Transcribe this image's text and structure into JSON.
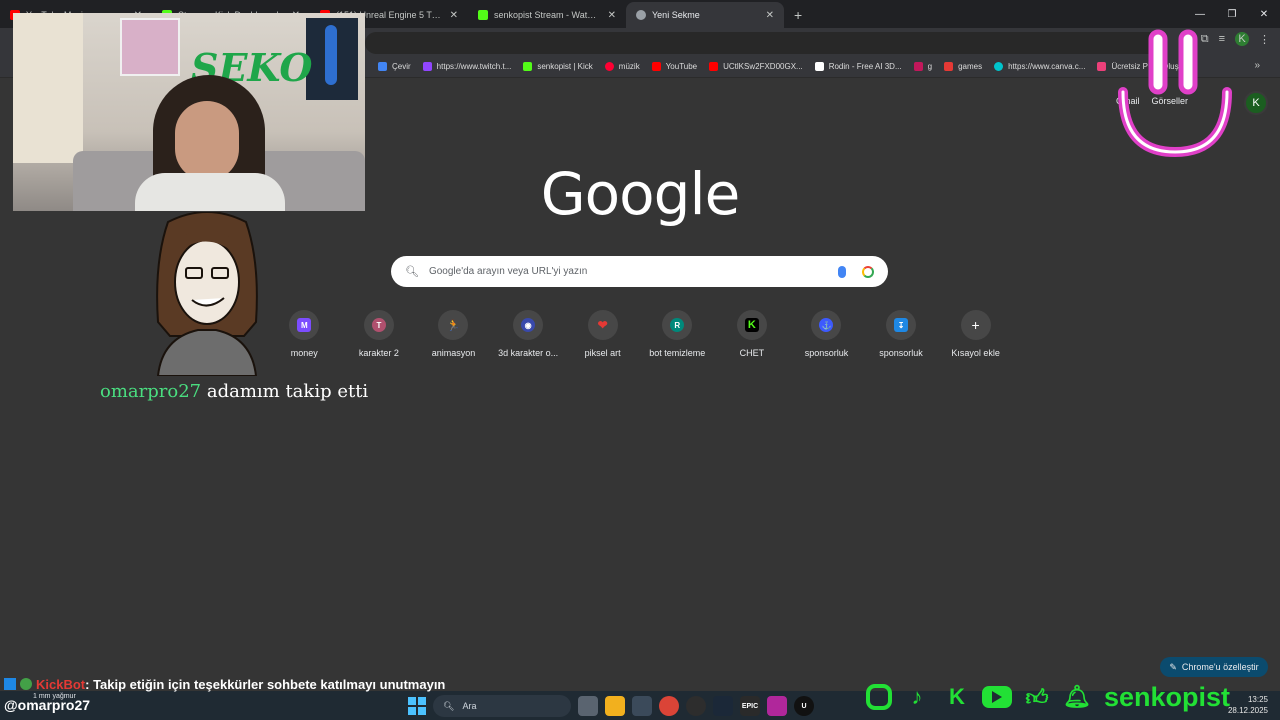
{
  "browser": {
    "tabs": [
      {
        "label": "YouTube Music",
        "favicon_color": "#ff0000",
        "active": false
      },
      {
        "label": "Stream - Kick Dashboard",
        "favicon_color": "#53fc18",
        "active": false
      },
      {
        "label": "(151) Unreal Engine 5 Tutorial",
        "favicon_color": "#ff0000",
        "active": false
      },
      {
        "label": "senkopist Stream - Watch Live on Kick",
        "favicon_color": "#53fc18",
        "active": false
      },
      {
        "label": "Yeni Sekme",
        "favicon_color": "#9aa0a6",
        "active": true
      }
    ],
    "new_tab_icon": "plus-icon",
    "bookmarks": [
      {
        "label": "Çevir",
        "color": "#4285f4"
      },
      {
        "label": "https://www.twitch.t...",
        "color": "#9146ff"
      },
      {
        "label": "senkopist | Kick",
        "color": "#53fc18"
      },
      {
        "label": "müzik",
        "color": "#ff0033"
      },
      {
        "label": "YouTube",
        "color": "#ff0000"
      },
      {
        "label": "UCtlKSw2FXD00GX...",
        "color": "#ff0000"
      },
      {
        "label": "Rodin - Free AI 3D...",
        "color": "#ffffff"
      },
      {
        "label": "g",
        "color": "#c2185b"
      },
      {
        "label": "games",
        "color": "#e53935"
      },
      {
        "label": "https://www.canva.c...",
        "color": "#00c4cc"
      },
      {
        "label": "Ücretsiz PNG Oluşturu",
        "color": "#ec407a"
      }
    ],
    "profile_initial": "K"
  },
  "ntp": {
    "top_links": [
      "Gmail",
      "Görseller"
    ],
    "avatar_initial": "K",
    "logo": "Google",
    "search_placeholder": "Google'da arayın veya URL'yi yazın",
    "shortcuts": [
      {
        "label": "money",
        "icon": "M",
        "color": "#7c4dff"
      },
      {
        "label": "karakter 2",
        "icon": "T",
        "color": "#b0506e"
      },
      {
        "label": "animasyon",
        "icon": "🏃",
        "color": "#f57c00"
      },
      {
        "label": "3d karakter o...",
        "icon": "◉",
        "color": "#3949ab"
      },
      {
        "label": "piksel art",
        "icon": "❤",
        "color": "#e53935"
      },
      {
        "label": "bot temizleme",
        "icon": "R",
        "color": "#00897b"
      },
      {
        "label": "CHET",
        "icon": "K",
        "color": "#53fc18"
      },
      {
        "label": "sponsorluk",
        "icon": "⚓",
        "color": "#3d5afe"
      },
      {
        "label": "sponsorluk",
        "icon": "↧",
        "color": "#1e88e5"
      },
      {
        "label": "Kısayol ekle",
        "icon": "+",
        "color": "#474747"
      }
    ],
    "customize_label": "Chrome'u özelleştir"
  },
  "overlay": {
    "follow_user": "omarpro27",
    "follow_text": "adamım takip etti",
    "webcam_sign": "SEKO",
    "bot_name": "KickBot",
    "bot_message": ": Takip etiğin için teşekkürler sohbete katılmayı unutmayın",
    "handle": "@omarpro27",
    "brand": "senkopist",
    "brand_color": "#22e035"
  },
  "taskbar": {
    "weather": "1 mm yağmur",
    "search_label": "Ara",
    "time": "13:25",
    "date": "28.12.2025"
  }
}
